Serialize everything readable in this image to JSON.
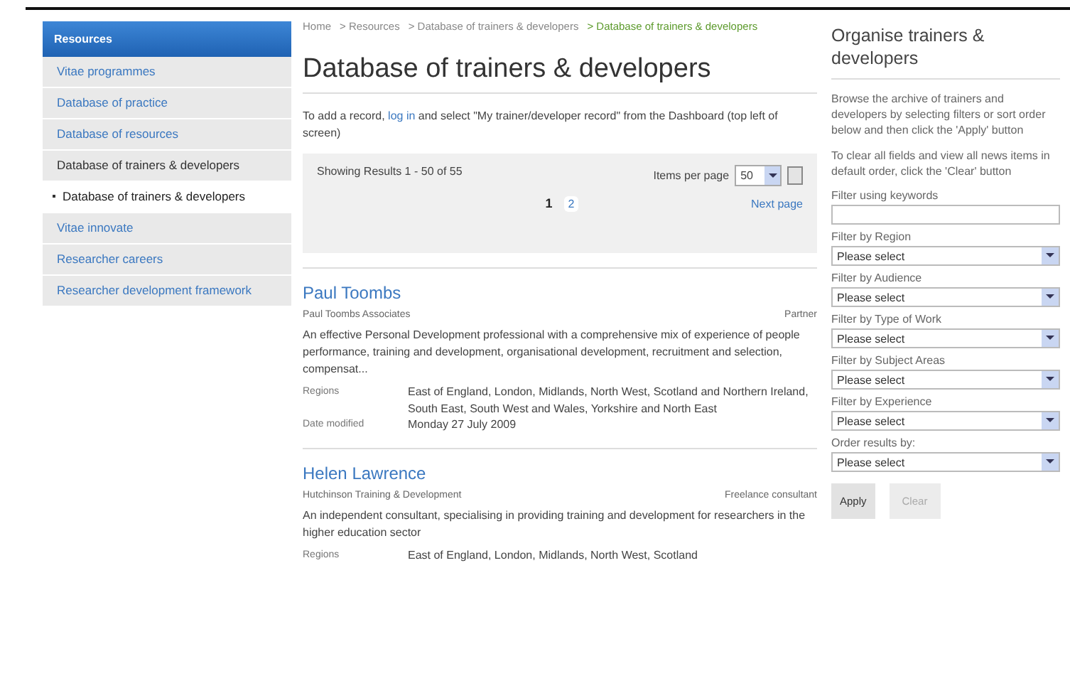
{
  "sidebar": {
    "header": "Resources",
    "items": [
      {
        "label": "Vitae programmes",
        "kind": "link",
        "selected": false
      },
      {
        "label": "Database of practice",
        "kind": "link",
        "selected": false
      },
      {
        "label": "Database of resources",
        "kind": "link",
        "selected": false
      },
      {
        "label": "Database of trainers & developers",
        "kind": "text",
        "selected": false
      },
      {
        "label": "Database of trainers & developers",
        "kind": "text",
        "selected": true
      },
      {
        "label": "Vitae innovate",
        "kind": "link",
        "selected": false
      },
      {
        "label": "Researcher careers",
        "kind": "link",
        "selected": false
      },
      {
        "label": "Researcher development framework",
        "kind": "link",
        "selected": false
      }
    ]
  },
  "breadcrumb": [
    {
      "label": "Home",
      "current": false
    },
    {
      "label": "> Resources",
      "current": false
    },
    {
      "label": "> Database of trainers & developers",
      "current": false
    },
    {
      "label": "> Database of trainers & developers",
      "current": true
    }
  ],
  "title": "Database of trainers & developers",
  "intro": {
    "before": "To add a record, ",
    "link": "log in",
    "after": " and select \"My trainer/developer record\" from the Dashboard (top left of screen)"
  },
  "results": {
    "summary": "Showing Results 1 - 50 of 55",
    "per_page_label": "Items per page",
    "per_page_value": "50",
    "pages": [
      {
        "label": "1",
        "selected": true
      },
      {
        "label": "2",
        "selected": false
      }
    ],
    "next": "Next page"
  },
  "entries": [
    {
      "name": "Paul Toombs",
      "organisation": "Paul Toombs Associates",
      "role": "Partner",
      "description": "An effective Personal Development professional with a comprehensive mix of experience of people performance, training and development, organisational development, recruitment and selection, compensat...",
      "details": [
        {
          "label": "Regions",
          "value": "East of England, London, Midlands, North West, Scotland and Northern Ireland, South East, South West and Wales, Yorkshire and North East"
        },
        {
          "label": "Date modified",
          "value": "Monday 27 July 2009"
        }
      ]
    },
    {
      "name": "Helen Lawrence",
      "organisation": "Hutchinson Training & Development",
      "role": "Freelance consultant",
      "description": "An independent consultant, specialising in providing training and development for researchers in the higher education sector",
      "details": [
        {
          "label": "Regions",
          "value": "East of England, London, Midlands, North West, Scotland"
        }
      ]
    }
  ],
  "panel": {
    "title": "Organise trainers & developers",
    "paragraphs": [
      "Browse the archive of trainers and developers by selecting filters or sort order below and then click the 'Apply' button",
      "To clear all fields and view all news items in default order, click the 'Clear' button"
    ],
    "keyword_label": "Filter using keywords",
    "filters": [
      {
        "label": "Filter by Region",
        "value": "Please select"
      },
      {
        "label": "Filter by Audience",
        "value": "Please select"
      },
      {
        "label": "Filter by Type of Work",
        "value": "Please select"
      },
      {
        "label": "Filter by Subject Areas",
        "value": "Please select"
      },
      {
        "label": "Filter by Experience",
        "value": "Please select"
      },
      {
        "label": "Order results by:",
        "value": "Please select"
      }
    ],
    "buttons": [
      {
        "label": "Apply",
        "disabled": false
      },
      {
        "label": "Clear",
        "disabled": true
      }
    ]
  }
}
